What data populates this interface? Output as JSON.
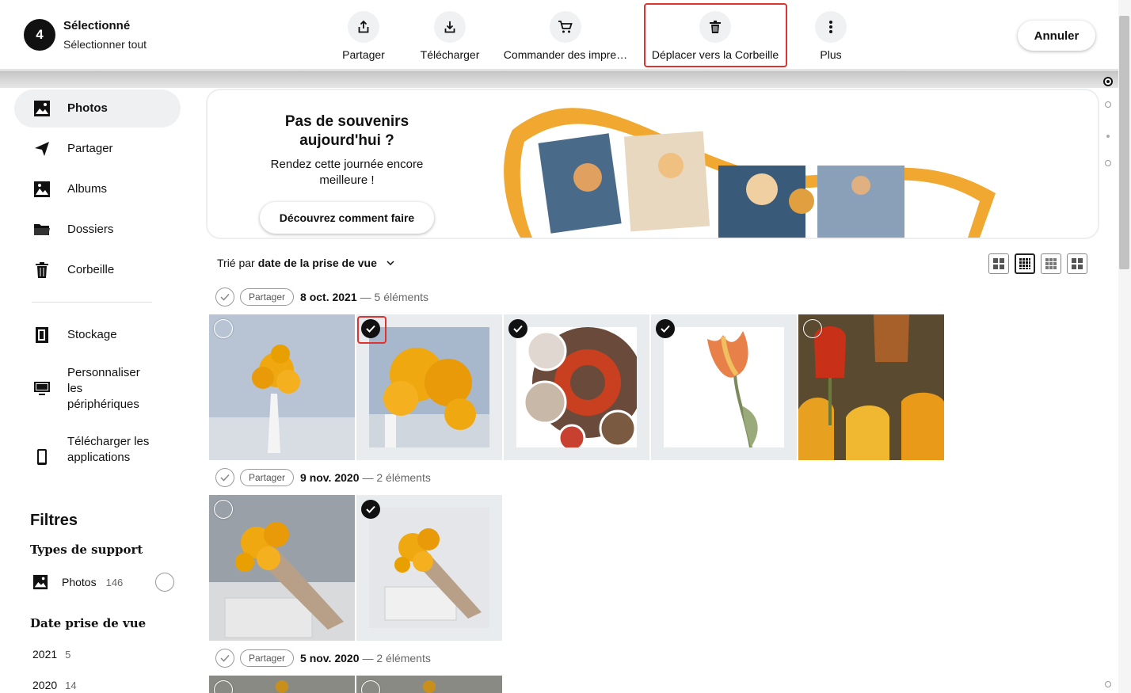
{
  "topbar": {
    "count": "4",
    "selected_label": "Sélectionné",
    "select_all": "Sélectionner tout",
    "actions": [
      {
        "label": "Partager",
        "icon": "share-icon"
      },
      {
        "label": "Télécharger",
        "icon": "download-icon"
      },
      {
        "label": "Commander des impre…",
        "icon": "cart-icon"
      },
      {
        "label": "Déplacer vers la Corbeille",
        "icon": "trash-icon"
      },
      {
        "label": "Plus",
        "icon": "more-vertical-icon"
      }
    ],
    "cancel": "Annuler"
  },
  "sidebar": {
    "items": [
      {
        "label": "Photos",
        "icon": "photo-icon"
      },
      {
        "label": "Partager",
        "icon": "paper-plane-icon"
      },
      {
        "label": "Albums",
        "icon": "album-icon"
      },
      {
        "label": "Dossiers",
        "icon": "folder-icon"
      },
      {
        "label": "Corbeille",
        "icon": "trash-icon"
      },
      {
        "label": "Stockage",
        "icon": "storage-icon"
      },
      {
        "label": "Personnaliser les périphériques",
        "icon": "monitor-icon"
      },
      {
        "label": "Télécharger les applications",
        "icon": "phone-icon"
      }
    ],
    "filters_title": "Filtres",
    "media_types_title": "Types de support",
    "media_photos": {
      "label": "Photos",
      "count": "146"
    },
    "date_title": "Date prise de vue",
    "years": [
      {
        "year": "2021",
        "count": "5"
      },
      {
        "year": "2020",
        "count": "14"
      }
    ]
  },
  "banner": {
    "title": "Pas de souvenirs aujourd'hui ?",
    "subtitle": "Rendez cette journée encore meilleure !",
    "button": "Découvrez comment faire"
  },
  "sort": {
    "prefix": "Trié par",
    "value": "date de la prise de vue"
  },
  "groups": [
    {
      "share": "Partager",
      "date": "8 oct. 2021",
      "count": "— 5 éléments"
    },
    {
      "share": "Partager",
      "date": "9 nov. 2020",
      "count": "— 2 éléments"
    },
    {
      "share": "Partager",
      "date": "5 nov. 2020",
      "count": "— 2 éléments"
    }
  ],
  "colors": {
    "accent_red": "#d33333",
    "selection_black": "#111111"
  }
}
